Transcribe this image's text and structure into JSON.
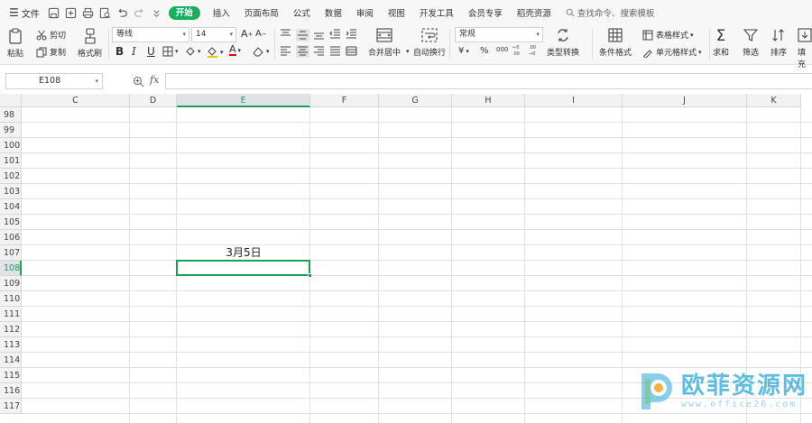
{
  "menubar": {
    "file_label": "文件",
    "tabs": [
      "开始",
      "插入",
      "页面布局",
      "公式",
      "数据",
      "审阅",
      "视图",
      "开发工具",
      "会员专享",
      "稻壳资源"
    ],
    "active_tab": "开始",
    "search_placeholder": "查找命令、搜索模板"
  },
  "ribbon": {
    "cut": "剪切",
    "paste": "粘贴",
    "copy": "复制",
    "format_painter": "格式刷",
    "font_name": "等线",
    "font_size": "14",
    "merge_center": "合并居中",
    "wrap_text": "自动换行",
    "number_format": "常规",
    "type_convert": "类型转换",
    "conditional_format": "条件格式",
    "table_style": "表格样式",
    "cell_style": "单元格样式",
    "sum": "求和",
    "filter": "筛选",
    "sort": "排序",
    "fill": "填充",
    "currency": "¥",
    "percent": "%",
    "thousands": "000",
    "bold": "B",
    "italic": "I",
    "underline": "U",
    "font_color_letter": "A"
  },
  "formula_bar": {
    "name_box": "E108",
    "fx": "fx",
    "value": ""
  },
  "sheet": {
    "columns": [
      "C",
      "D",
      "E",
      "F",
      "G",
      "H",
      "I",
      "J",
      "K"
    ],
    "selected_column": "E",
    "rows": [
      "98",
      "99",
      "100",
      "101",
      "102",
      "103",
      "104",
      "105",
      "106",
      "107",
      "108",
      "109",
      "110",
      "111",
      "112",
      "113",
      "114",
      "115",
      "116",
      "117"
    ],
    "selected_row": "108",
    "cell_E107": "3月5日"
  },
  "watermark": {
    "title": "欧菲资源网",
    "url": "www.office26.com"
  },
  "colors": {
    "accent": "#1aae5f",
    "selection": "#1a9f55",
    "header_bg": "#f2f2f2",
    "watermark": "#2aa7d9"
  }
}
